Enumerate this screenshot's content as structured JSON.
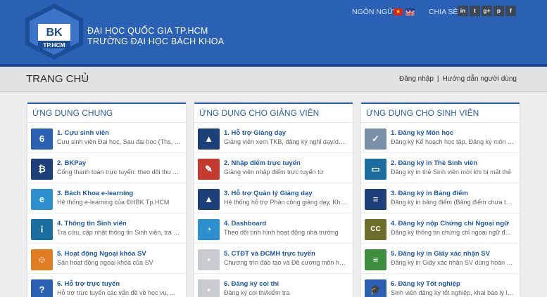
{
  "header": {
    "logo_text_top": "BK",
    "logo_text_bottom": "TP.HCM",
    "org_line1": "ĐẠI HỌC QUỐC GIA TP.HCM",
    "org_line2": "TRƯỜNG ĐẠI HỌC BÁCH KHOA",
    "language_label": "NGÔN NGỮ",
    "share_label": "CHIA SẺ",
    "social": [
      "in",
      "t",
      "g+",
      "p",
      "f"
    ]
  },
  "breadcrumb": {
    "title": "TRANG CHỦ",
    "chevron": "»",
    "login": "Đăng nhập",
    "separator": "|",
    "guide": "Hướng dẫn người dùng"
  },
  "panels": [
    {
      "title": "ỨNG DỤNG CHUNG",
      "items": [
        {
          "title": "1. Cựu sinh viên",
          "desc": "Cựu sinh viên Đại học, Sau đại học (Ths, TS)",
          "icon": "alumni-icon",
          "glyph": "6"
        },
        {
          "title": "2. BKPay",
          "desc": "Cổng thanh toán trực tuyến: theo dõi thu nhập, học phí",
          "icon": "bkpay-icon",
          "glyph": "₿"
        },
        {
          "title": "3. Bách Khoa e-learning",
          "desc": "Hệ thống e-learning của ĐHBK Tp.HCM",
          "icon": "elearning-icon",
          "glyph": "e"
        },
        {
          "title": "4. Thông tin Sinh viên",
          "desc": "Tra cứu, cập nhật thông tin Sinh viên, tra cứu TKB",
          "icon": "student-info-icon",
          "glyph": "i"
        },
        {
          "title": "5. Hoạt động Ngoại khóa SV",
          "desc": "Sản hoạt động ngoại khóa của SV",
          "icon": "activity-icon",
          "glyph": "☺"
        },
        {
          "title": "6. Hỗ trợ trực tuyến",
          "desc": "Hỗ trợ trực tuyến các vấn đề về học vụ, ...",
          "icon": "online-support-icon",
          "glyph": "?"
        }
      ]
    },
    {
      "title": "ỨNG DỤNG CHO GIẢNG VIÊN",
      "items": [
        {
          "title": "1. Hỗ trợ Giảng dạy",
          "desc": "Giảng viên xem TKB, đăng ký nghỉ dạy/dạy bù/...",
          "icon": "teaching-support-icon",
          "glyph": "▲"
        },
        {
          "title": "2. Nhập điểm trực tuyến",
          "desc": "Giảng viên nhập điểm trực tuyến từ",
          "icon": "grade-entry-icon",
          "glyph": "✎"
        },
        {
          "title": "3. Hỗ trợ Quản lý Giảng dạy",
          "desc": "Hệ thống hỗ trợ Phân công giảng dạy, Khối lượng...",
          "icon": "teaching-management-icon",
          "glyph": "▲"
        },
        {
          "title": "4. Dashboard",
          "desc": "Theo dõi tình hình hoạt động nhà trường",
          "icon": "dashboard-icon",
          "glyph": "◔"
        },
        {
          "title": "5. CTĐT và ĐCMH trực tuyến",
          "desc": "Chương trìn đào tạo và Đề cương môn học trực...",
          "icon": "curriculum-icon",
          "glyph": "▪"
        },
        {
          "title": "6. Đăng ký coi thi",
          "desc": "Đăng ký coi thi/kiểm tra",
          "icon": "exam-proctor-icon",
          "glyph": "▪"
        }
      ]
    },
    {
      "title": "ỨNG DỤNG CHO SINH VIÊN",
      "items": [
        {
          "title": "1. Đăng ký Môn học",
          "desc": "Đăng ký Kế hoạch học tập, Đăng ký môn học, ...",
          "icon": "course-registration-icon",
          "glyph": "✓"
        },
        {
          "title": "2. Đăng ký in Thẻ Sinh viên",
          "desc": "Đăng ký in thẻ Sinh viên mới khi bị mất thẻ",
          "icon": "student-card-icon",
          "glyph": "▭"
        },
        {
          "title": "3. Đăng ký in Bảng điểm",
          "desc": "Đăng ký in bảng điểm (Bảng điểm chưa tốt nghiệp)",
          "icon": "transcript-icon",
          "glyph": "≡"
        },
        {
          "title": "4. Đăng ký nộp Chứng chỉ Ngoại ngữ",
          "desc": "Đăng ký thông tin chứng chỉ ngoại ngữ để được xét",
          "icon": "language-cert-icon",
          "glyph": "CC"
        },
        {
          "title": "5. Đăng ký in Giấy xác nhận SV",
          "desc": "Đăng ký in Giấy xác nhận SV dùng hoàn tất hồ sơ",
          "icon": "student-confirmation-icon",
          "glyph": "≡"
        },
        {
          "title": "6. Đăng ký Tốt nghiệp",
          "desc": "Sinh viên đăng ký tốt nghiệp, khai báo lý lịch tốt...",
          "icon": "graduation-icon",
          "glyph": "🎓"
        }
      ]
    }
  ],
  "colors": {
    "header_bg": "#2a61b4",
    "accent": "#2a61b4",
    "link": "#1d58b3"
  }
}
